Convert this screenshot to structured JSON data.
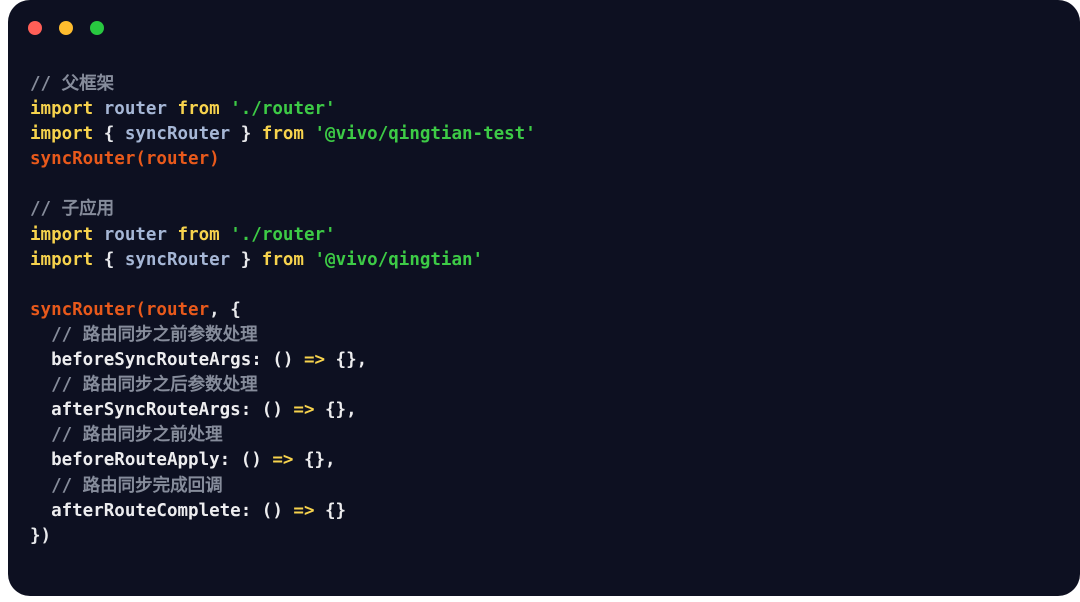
{
  "window": {
    "name": "code-snippet-window",
    "background_color": "#0D1021",
    "controls": [
      {
        "name": "close",
        "color": "#FF5F57"
      },
      {
        "name": "minimize",
        "color": "#FEBC2E"
      },
      {
        "name": "maximize",
        "color": "#28C840"
      }
    ]
  },
  "theme": {
    "comment": "#868C9B",
    "keyword": "#F7D34D",
    "identifier": "#A6B7D6",
    "string": "#3DCB46",
    "function": "#E8591B",
    "punctuation": "#E8E9EC",
    "property": "#EDEDEF",
    "arrow": "#F7D34D"
  },
  "code": {
    "lines": [
      {
        "tokens": [
          {
            "t": "comment",
            "v": "// 父框架"
          }
        ]
      },
      {
        "tokens": [
          {
            "t": "keyword",
            "v": "import"
          },
          {
            "t": "punct",
            "v": " "
          },
          {
            "t": "ident",
            "v": "router"
          },
          {
            "t": "punct",
            "v": " "
          },
          {
            "t": "keyword",
            "v": "from"
          },
          {
            "t": "punct",
            "v": " "
          },
          {
            "t": "string",
            "v": "'./router'"
          }
        ]
      },
      {
        "tokens": [
          {
            "t": "keyword",
            "v": "import"
          },
          {
            "t": "punct",
            "v": " { "
          },
          {
            "t": "ident",
            "v": "syncRouter"
          },
          {
            "t": "punct",
            "v": " } "
          },
          {
            "t": "keyword",
            "v": "from"
          },
          {
            "t": "punct",
            "v": " "
          },
          {
            "t": "string",
            "v": "'@vivo/qingtian-test'"
          }
        ]
      },
      {
        "tokens": [
          {
            "t": "func",
            "v": "syncRouter(router)"
          }
        ]
      },
      {
        "tokens": []
      },
      {
        "tokens": [
          {
            "t": "comment",
            "v": "// 子应用"
          }
        ]
      },
      {
        "tokens": [
          {
            "t": "keyword",
            "v": "import"
          },
          {
            "t": "punct",
            "v": " "
          },
          {
            "t": "ident",
            "v": "router"
          },
          {
            "t": "punct",
            "v": " "
          },
          {
            "t": "keyword",
            "v": "from"
          },
          {
            "t": "punct",
            "v": " "
          },
          {
            "t": "string",
            "v": "'./router'"
          }
        ]
      },
      {
        "tokens": [
          {
            "t": "keyword",
            "v": "import"
          },
          {
            "t": "punct",
            "v": " { "
          },
          {
            "t": "ident",
            "v": "syncRouter"
          },
          {
            "t": "punct",
            "v": " } "
          },
          {
            "t": "keyword",
            "v": "from"
          },
          {
            "t": "punct",
            "v": " "
          },
          {
            "t": "string",
            "v": "'@vivo/qingtian'"
          }
        ]
      },
      {
        "tokens": []
      },
      {
        "tokens": [
          {
            "t": "func",
            "v": "syncRouter(router"
          },
          {
            "t": "punct",
            "v": ", {"
          }
        ]
      },
      {
        "tokens": [
          {
            "t": "comment",
            "v": "  // 路由同步之前参数处理"
          }
        ]
      },
      {
        "tokens": [
          {
            "t": "prop",
            "v": "  beforeSyncRouteArgs: () "
          },
          {
            "t": "arrow",
            "v": "=>"
          },
          {
            "t": "prop",
            "v": " {},"
          }
        ]
      },
      {
        "tokens": [
          {
            "t": "comment",
            "v": "  // 路由同步之后参数处理"
          }
        ]
      },
      {
        "tokens": [
          {
            "t": "prop",
            "v": "  afterSyncRouteArgs: () "
          },
          {
            "t": "arrow",
            "v": "=>"
          },
          {
            "t": "prop",
            "v": " {},"
          }
        ]
      },
      {
        "tokens": [
          {
            "t": "comment",
            "v": "  // 路由同步之前处理"
          }
        ]
      },
      {
        "tokens": [
          {
            "t": "prop",
            "v": "  beforeRouteApply: () "
          },
          {
            "t": "arrow",
            "v": "=>"
          },
          {
            "t": "prop",
            "v": " {},"
          }
        ]
      },
      {
        "tokens": [
          {
            "t": "comment",
            "v": "  // 路由同步完成回调"
          }
        ]
      },
      {
        "tokens": [
          {
            "t": "prop",
            "v": "  afterRouteComplete: () "
          },
          {
            "t": "arrow",
            "v": "=>"
          },
          {
            "t": "prop",
            "v": " {}"
          }
        ]
      },
      {
        "tokens": [
          {
            "t": "punct",
            "v": "})"
          }
        ]
      }
    ]
  }
}
